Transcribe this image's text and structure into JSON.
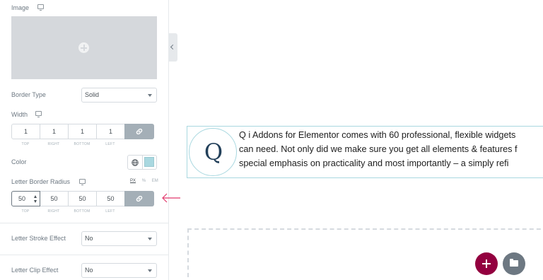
{
  "panel": {
    "image": {
      "label": "Image"
    },
    "border_type": {
      "label": "Border Type",
      "value": "Solid"
    },
    "width": {
      "label": "Width",
      "values": [
        "1",
        "1",
        "1",
        "1"
      ],
      "sublabels": [
        "TOP",
        "RIGHT",
        "BOTTOM",
        "LEFT"
      ]
    },
    "color": {
      "label": "Color",
      "swatch": "#a9d8e0"
    },
    "letter_border_radius": {
      "label": "Letter Border Radius",
      "units": [
        "PX",
        "%",
        "EM"
      ],
      "selected_unit": "PX",
      "values": [
        "50",
        "50",
        "50",
        "50"
      ],
      "sublabels": [
        "TOP",
        "RIGHT",
        "BOTTOM",
        "LEFT"
      ]
    },
    "letter_stroke_effect": {
      "label": "Letter Stroke Effect",
      "value": "No"
    },
    "letter_clip_effect": {
      "label": "Letter Clip Effect",
      "value": "No"
    }
  },
  "canvas": {
    "drop_letter": "Q",
    "lines": [
      "Q i Addons for Elementor comes with 60 professional, flexible widgets",
      "can need. Not only did we make sure you get all elements & features f",
      "special emphasis on practicality and most importantly – a simply refi"
    ]
  },
  "colors": {
    "accent": "#93003f",
    "link_button": "#a4afb7",
    "widget_border": "#a9d8e0",
    "arrow": "#e2386c"
  }
}
